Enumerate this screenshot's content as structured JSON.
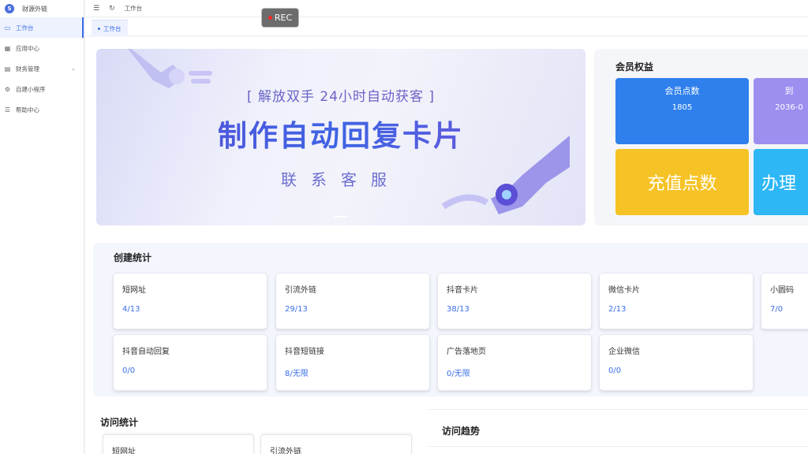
{
  "app": {
    "title": "财源外链",
    "logo_text": "S"
  },
  "sidebar": {
    "items": [
      {
        "label": "工作台",
        "icon": "monitor-icon",
        "glyph": "▭",
        "active": true
      },
      {
        "label": "应用中心",
        "icon": "grid-icon",
        "glyph": "▦",
        "active": false
      },
      {
        "label": "财务管理",
        "icon": "finance-icon",
        "glyph": "▤",
        "active": false,
        "chevron": "⌄"
      },
      {
        "label": "自建小程序",
        "icon": "gear-icon",
        "glyph": "⚙",
        "active": false
      },
      {
        "label": "帮助中心",
        "icon": "sliders-icon",
        "glyph": "☰",
        "active": false
      }
    ]
  },
  "header": {
    "menu_glyph": "☰",
    "refresh_glyph": "↻",
    "breadcrumb": "工作台"
  },
  "tabs": [
    {
      "label": "工作台"
    }
  ],
  "recorder": {
    "label": "REC"
  },
  "banner": {
    "subtitle": "[ 解放双手  24小时自动获客 ]",
    "title": "制作自动回复卡片",
    "contact": "联系客服"
  },
  "member": {
    "title": "会员权益",
    "points_label": "会员点数",
    "points_value": "1805",
    "expiry_label": "到",
    "expiry_value": "2036-0",
    "recharge_label": "充值点数",
    "handle_label": "办理"
  },
  "create_stats": {
    "title": "创建统计",
    "items": [
      {
        "name": "短网址",
        "value": "4/13"
      },
      {
        "name": "引流外链",
        "value": "29/13"
      },
      {
        "name": "抖音卡片",
        "value": "38/13"
      },
      {
        "name": "微信卡片",
        "value": "2/13"
      },
      {
        "name": "小圆码",
        "value": "7/0"
      },
      {
        "name": "抖音自动回复",
        "value": "0/0"
      },
      {
        "name": "抖音短链接",
        "value": "8/无限"
      },
      {
        "name": "广告落地页",
        "value": "0/无限"
      },
      {
        "name": "企业微信",
        "value": "0/0"
      }
    ]
  },
  "visit_stats": {
    "title": "访问统计",
    "items": [
      {
        "name": "短网址"
      },
      {
        "name": "引流外链"
      }
    ]
  },
  "trend": {
    "title": "访问趋势"
  },
  "colors": {
    "accent": "#3a6ee8",
    "card_blue": "#2f80ed",
    "card_purple": "#9b8ff0",
    "card_yellow": "#f6c326",
    "card_cyan": "#2db7f5"
  }
}
